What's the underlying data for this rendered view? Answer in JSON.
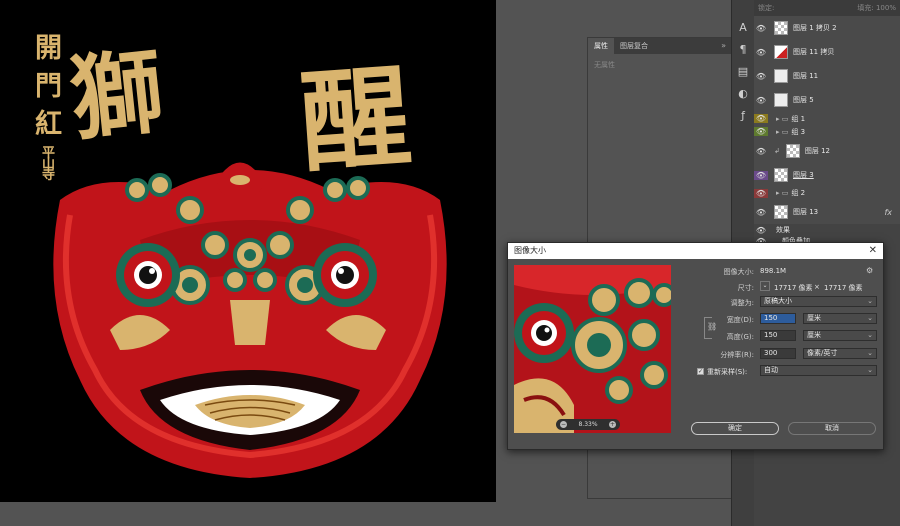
{
  "canvas": {
    "calligraphy_left": "獅",
    "calligraphy_right": "醒",
    "vertical_text": [
      "開",
      "門",
      "紅"
    ],
    "signature": "平山寺"
  },
  "properties_panel": {
    "tabs": [
      "属性",
      "图层复合"
    ],
    "menu_icon": "»",
    "empty_text": "无属性"
  },
  "tool_strip": {
    "icons": [
      "type-icon",
      "character-icon",
      "paragraph-icon",
      "adjustment-icon",
      "fx-icon"
    ]
  },
  "layers_panel": {
    "top_label_left": "锁定:",
    "top_label_right": "填充: 100%",
    "layers": [
      {
        "name": "图层 1 拷贝 2",
        "kind": "layer",
        "thumb": "check",
        "color": ""
      },
      {
        "name": "图层 11 拷贝",
        "kind": "layer",
        "thumb": "red",
        "color": ""
      },
      {
        "name": "图层 11",
        "kind": "layer",
        "thumb": "plain",
        "color": ""
      },
      {
        "name": "图层 5",
        "kind": "layer",
        "thumb": "plain",
        "color": ""
      },
      {
        "name": "组 1",
        "kind": "group",
        "color": "#8b7a1e"
      },
      {
        "name": "组 3",
        "kind": "group",
        "color": "#5e7a2e"
      },
      {
        "name": "图层 12",
        "kind": "layer",
        "thumb": "check",
        "color": ""
      },
      {
        "name": "图层 3",
        "kind": "layer",
        "thumb": "check",
        "color": "#6a4a8a"
      },
      {
        "name": "组 2",
        "kind": "group",
        "color": "#8a3a3a"
      },
      {
        "name": "图层 13",
        "kind": "layer",
        "thumb": "check",
        "color": "",
        "fx": "fx"
      }
    ],
    "effects_label": "效果",
    "effect_item": "颜色叠加"
  },
  "dialog": {
    "title": "图像大小",
    "close": "✕",
    "image_size_label": "图像大小:",
    "image_size_value": "898.1M",
    "dimensions_label": "尺寸:",
    "dim_w": "17717 像素",
    "dim_x": "×",
    "dim_h": "17717 像素",
    "fit_to_label": "调整为:",
    "fit_to_value": "原稿大小",
    "width_label": "宽度(D):",
    "width_value": "150",
    "width_unit": "厘米",
    "height_label": "高度(G):",
    "height_value": "150",
    "height_unit": "厘米",
    "resolution_label": "分辨率(R):",
    "resolution_value": "300",
    "resolution_unit": "像素/英寸",
    "resample_label": "重新采样(S):",
    "resample_value": "自动",
    "zoom_value": "8.33%",
    "ok_label": "确定",
    "cancel_label": "取消"
  }
}
